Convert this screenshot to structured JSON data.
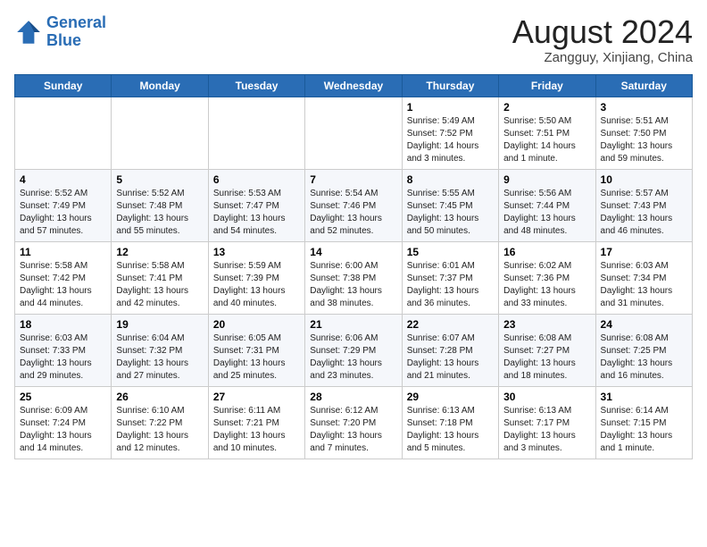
{
  "header": {
    "logo_line1": "General",
    "logo_line2": "Blue",
    "month_year": "August 2024",
    "location": "Zangguy, Xinjiang, China"
  },
  "weekdays": [
    "Sunday",
    "Monday",
    "Tuesday",
    "Wednesday",
    "Thursday",
    "Friday",
    "Saturday"
  ],
  "weeks": [
    [
      {
        "day": "",
        "info": ""
      },
      {
        "day": "",
        "info": ""
      },
      {
        "day": "",
        "info": ""
      },
      {
        "day": "",
        "info": ""
      },
      {
        "day": "1",
        "info": "Sunrise: 5:49 AM\nSunset: 7:52 PM\nDaylight: 14 hours\nand 3 minutes."
      },
      {
        "day": "2",
        "info": "Sunrise: 5:50 AM\nSunset: 7:51 PM\nDaylight: 14 hours\nand 1 minute."
      },
      {
        "day": "3",
        "info": "Sunrise: 5:51 AM\nSunset: 7:50 PM\nDaylight: 13 hours\nand 59 minutes."
      }
    ],
    [
      {
        "day": "4",
        "info": "Sunrise: 5:52 AM\nSunset: 7:49 PM\nDaylight: 13 hours\nand 57 minutes."
      },
      {
        "day": "5",
        "info": "Sunrise: 5:52 AM\nSunset: 7:48 PM\nDaylight: 13 hours\nand 55 minutes."
      },
      {
        "day": "6",
        "info": "Sunrise: 5:53 AM\nSunset: 7:47 PM\nDaylight: 13 hours\nand 54 minutes."
      },
      {
        "day": "7",
        "info": "Sunrise: 5:54 AM\nSunset: 7:46 PM\nDaylight: 13 hours\nand 52 minutes."
      },
      {
        "day": "8",
        "info": "Sunrise: 5:55 AM\nSunset: 7:45 PM\nDaylight: 13 hours\nand 50 minutes."
      },
      {
        "day": "9",
        "info": "Sunrise: 5:56 AM\nSunset: 7:44 PM\nDaylight: 13 hours\nand 48 minutes."
      },
      {
        "day": "10",
        "info": "Sunrise: 5:57 AM\nSunset: 7:43 PM\nDaylight: 13 hours\nand 46 minutes."
      }
    ],
    [
      {
        "day": "11",
        "info": "Sunrise: 5:58 AM\nSunset: 7:42 PM\nDaylight: 13 hours\nand 44 minutes."
      },
      {
        "day": "12",
        "info": "Sunrise: 5:58 AM\nSunset: 7:41 PM\nDaylight: 13 hours\nand 42 minutes."
      },
      {
        "day": "13",
        "info": "Sunrise: 5:59 AM\nSunset: 7:39 PM\nDaylight: 13 hours\nand 40 minutes."
      },
      {
        "day": "14",
        "info": "Sunrise: 6:00 AM\nSunset: 7:38 PM\nDaylight: 13 hours\nand 38 minutes."
      },
      {
        "day": "15",
        "info": "Sunrise: 6:01 AM\nSunset: 7:37 PM\nDaylight: 13 hours\nand 36 minutes."
      },
      {
        "day": "16",
        "info": "Sunrise: 6:02 AM\nSunset: 7:36 PM\nDaylight: 13 hours\nand 33 minutes."
      },
      {
        "day": "17",
        "info": "Sunrise: 6:03 AM\nSunset: 7:34 PM\nDaylight: 13 hours\nand 31 minutes."
      }
    ],
    [
      {
        "day": "18",
        "info": "Sunrise: 6:03 AM\nSunset: 7:33 PM\nDaylight: 13 hours\nand 29 minutes."
      },
      {
        "day": "19",
        "info": "Sunrise: 6:04 AM\nSunset: 7:32 PM\nDaylight: 13 hours\nand 27 minutes."
      },
      {
        "day": "20",
        "info": "Sunrise: 6:05 AM\nSunset: 7:31 PM\nDaylight: 13 hours\nand 25 minutes."
      },
      {
        "day": "21",
        "info": "Sunrise: 6:06 AM\nSunset: 7:29 PM\nDaylight: 13 hours\nand 23 minutes."
      },
      {
        "day": "22",
        "info": "Sunrise: 6:07 AM\nSunset: 7:28 PM\nDaylight: 13 hours\nand 21 minutes."
      },
      {
        "day": "23",
        "info": "Sunrise: 6:08 AM\nSunset: 7:27 PM\nDaylight: 13 hours\nand 18 minutes."
      },
      {
        "day": "24",
        "info": "Sunrise: 6:08 AM\nSunset: 7:25 PM\nDaylight: 13 hours\nand 16 minutes."
      }
    ],
    [
      {
        "day": "25",
        "info": "Sunrise: 6:09 AM\nSunset: 7:24 PM\nDaylight: 13 hours\nand 14 minutes."
      },
      {
        "day": "26",
        "info": "Sunrise: 6:10 AM\nSunset: 7:22 PM\nDaylight: 13 hours\nand 12 minutes."
      },
      {
        "day": "27",
        "info": "Sunrise: 6:11 AM\nSunset: 7:21 PM\nDaylight: 13 hours\nand 10 minutes."
      },
      {
        "day": "28",
        "info": "Sunrise: 6:12 AM\nSunset: 7:20 PM\nDaylight: 13 hours\nand 7 minutes."
      },
      {
        "day": "29",
        "info": "Sunrise: 6:13 AM\nSunset: 7:18 PM\nDaylight: 13 hours\nand 5 minutes."
      },
      {
        "day": "30",
        "info": "Sunrise: 6:13 AM\nSunset: 7:17 PM\nDaylight: 13 hours\nand 3 minutes."
      },
      {
        "day": "31",
        "info": "Sunrise: 6:14 AM\nSunset: 7:15 PM\nDaylight: 13 hours\nand 1 minute."
      }
    ]
  ]
}
